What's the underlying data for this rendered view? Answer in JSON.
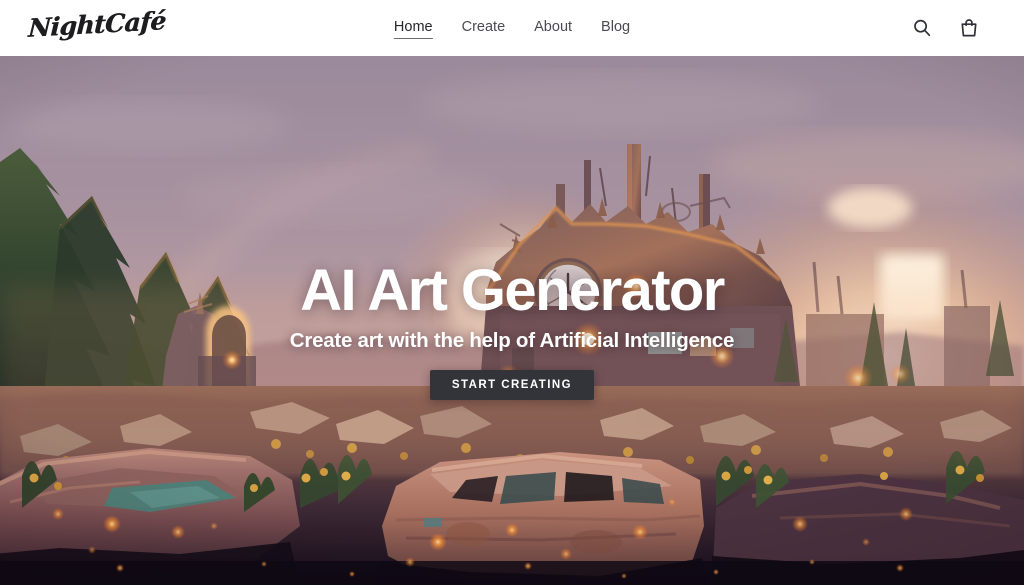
{
  "header": {
    "logo_text": "NightCafé",
    "nav": [
      {
        "label": "Home",
        "active": true
      },
      {
        "label": "Create",
        "active": false
      },
      {
        "label": "About",
        "active": false
      },
      {
        "label": "Blog",
        "active": false
      }
    ],
    "icons": [
      {
        "name": "search-icon",
        "label": "Search"
      },
      {
        "name": "shopping-bag-icon",
        "label": "Cart"
      }
    ]
  },
  "hero": {
    "title": "AI Art Generator",
    "subtitle": "Create art with the help of Artificial Intelligence",
    "cta_label": "START CREATING",
    "image_alt": "Post-apocalyptic junkyard city at sunset with a ruined clock tower, rusted abandoned cars and glowing orange lights",
    "colors": {
      "sky_top": "#9e8d9c",
      "sky_mid": "#b9a0a4",
      "sun_glow": "#ffe6cf",
      "rust": "#b5663c",
      "ember": "#ff9e3d",
      "foliage": "#31412c",
      "ground_dark": "#1b1220",
      "cta_bg": "#32343a",
      "text_white": "#ffffff",
      "nav_text": "#4a4a52",
      "header_bg": "#ffffff"
    }
  }
}
